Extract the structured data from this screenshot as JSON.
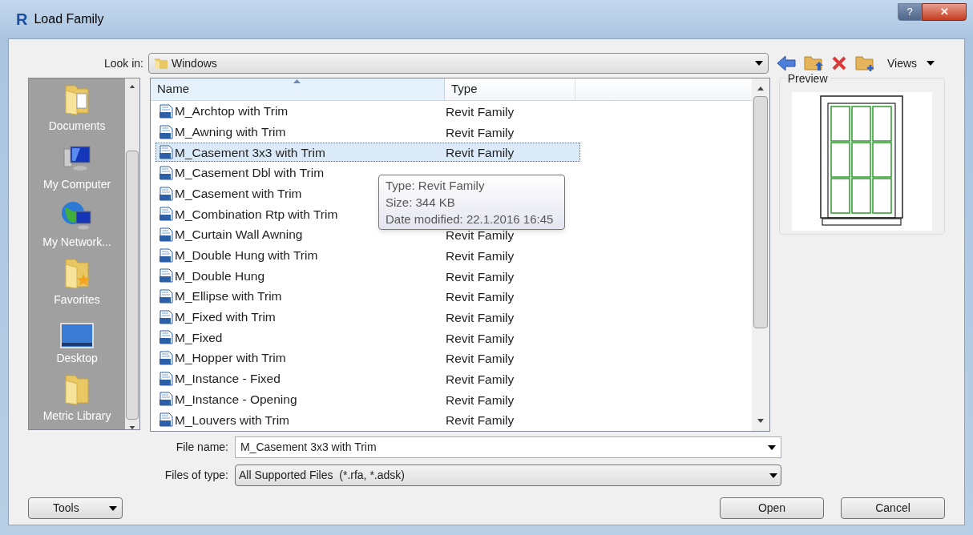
{
  "window": {
    "logo_letter": "R",
    "title": "Load Family",
    "help_glyph": "?",
    "close_glyph": "✕"
  },
  "look_in": {
    "label": "Look in:",
    "value": "Windows"
  },
  "toolbar": {
    "views_label": "Views"
  },
  "places": [
    {
      "kind": "documents",
      "label": "Documents"
    },
    {
      "kind": "computer",
      "label": "My Computer"
    },
    {
      "kind": "network",
      "label": "My Network..."
    },
    {
      "kind": "favorites",
      "label": "Favorites"
    },
    {
      "kind": "desktop",
      "label": "Desktop"
    },
    {
      "kind": "folder",
      "label": "Metric Library"
    }
  ],
  "table": {
    "columns": [
      "Name",
      "Type"
    ],
    "rows": [
      {
        "name": "M_Archtop with Trim",
        "type": "Revit Family",
        "selected": false
      },
      {
        "name": "M_Awning with Trim",
        "type": "Revit Family",
        "selected": false
      },
      {
        "name": "M_Casement 3x3 with Trim",
        "type": "Revit Family",
        "selected": true
      },
      {
        "name": "M_Casement Dbl with Trim",
        "selected": false
      },
      {
        "name": "M_Casement with Trim",
        "selected": false
      },
      {
        "name": "M_Combination Rtp with Trim",
        "selected": false
      },
      {
        "name": "M_Curtain Wall Awning",
        "type": "Revit Family",
        "selected": false
      },
      {
        "name": "M_Double Hung with Trim",
        "type": "Revit Family",
        "selected": false
      },
      {
        "name": "M_Double Hung",
        "type": "Revit Family",
        "selected": false
      },
      {
        "name": "M_Ellipse with Trim",
        "type": "Revit Family",
        "selected": false
      },
      {
        "name": "M_Fixed with Trim",
        "type": "Revit Family",
        "selected": false
      },
      {
        "name": "M_Fixed",
        "type": "Revit Family",
        "selected": false
      },
      {
        "name": "M_Hopper with Trim",
        "type": "Revit Family",
        "selected": false
      },
      {
        "name": "M_Instance - Fixed",
        "type": "Revit Family",
        "selected": false
      },
      {
        "name": "M_Instance - Opening",
        "type": "Revit Family",
        "selected": false
      },
      {
        "name": "M_Louvers with Trim",
        "type": "Revit Family",
        "selected": false
      }
    ]
  },
  "tooltip": [
    "Type: Revit Family",
    "Size: 344 KB",
    "Date modified: 22.1.2016 16:45"
  ],
  "preview": {
    "label": "Preview"
  },
  "file_name": {
    "label": "File name:",
    "value": "M_Casement 3x3 with Trim"
  },
  "files_of_type": {
    "label": "Files of type:",
    "value": "All Supported Files  (*.rfa, *.adsk)"
  },
  "buttons": {
    "tools": "Tools",
    "open": "Open",
    "cancel": "Cancel"
  }
}
